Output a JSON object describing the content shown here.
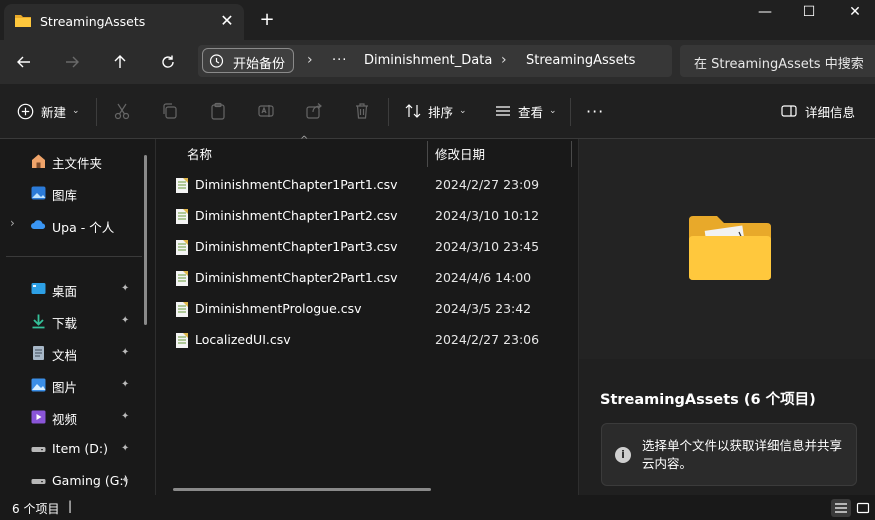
{
  "window": {
    "tab_title": "StreamingAssets",
    "tab_close": "✕",
    "new_tab": "+",
    "minimize": "—",
    "maximize": "☐",
    "close": "✕"
  },
  "address": {
    "backup_label": "开始备份",
    "more": "···",
    "crumbs": [
      "Diminishment_Data",
      "StreamingAssets"
    ],
    "separator": "›",
    "search_placeholder": "在 StreamingAssets 中搜索"
  },
  "toolbar": {
    "new_label": "新建",
    "sort_label": "排序",
    "view_label": "查看",
    "more": "···",
    "details_label": "详细信息"
  },
  "sidebar": {
    "items": [
      {
        "label": "主文件夹",
        "icon": "home-icon"
      },
      {
        "label": "图库",
        "icon": "gallery-icon"
      },
      {
        "label": "Upa - 个人",
        "icon": "onedrive-cloud-icon"
      },
      {
        "label": "桌面",
        "icon": "desktop-icon",
        "pinned": true
      },
      {
        "label": "下载",
        "icon": "download-icon",
        "pinned": true
      },
      {
        "label": "文档",
        "icon": "document-icon",
        "pinned": true
      },
      {
        "label": "图片",
        "icon": "pictures-icon",
        "pinned": true
      },
      {
        "label": "视频",
        "icon": "video-icon",
        "pinned": true
      },
      {
        "label": "Item (D:)",
        "icon": "drive-icon",
        "pinned": true
      },
      {
        "label": "Gaming (G:)",
        "icon": "drive-icon",
        "pinned": true
      }
    ],
    "pin_glyph": "📌"
  },
  "files": {
    "columns": {
      "name": "名称",
      "date": "修改日期"
    },
    "rows": [
      {
        "name": "DiminishmentChapter1Part1.csv",
        "date": "2024/2/27 23:09"
      },
      {
        "name": "DiminishmentChapter1Part2.csv",
        "date": "2024/3/10 10:12"
      },
      {
        "name": "DiminishmentChapter1Part3.csv",
        "date": "2024/3/10 23:45"
      },
      {
        "name": "DiminishmentChapter2Part1.csv",
        "date": "2024/4/6 14:00"
      },
      {
        "name": "DiminishmentPrologue.csv",
        "date": "2024/3/5 23:42"
      },
      {
        "name": "LocalizedUI.csv",
        "date": "2024/2/27 23:06"
      }
    ]
  },
  "details": {
    "title": "StreamingAssets (6 个项目)",
    "info_text": "选择单个文件以获取详细信息并共享云内容。"
  },
  "status": {
    "count_text": "6 个项目",
    "caret": "|"
  },
  "colors": {
    "accent_blue": "#4cc2ff",
    "folder_yellow": "#ffc83d",
    "background": "#191919"
  }
}
